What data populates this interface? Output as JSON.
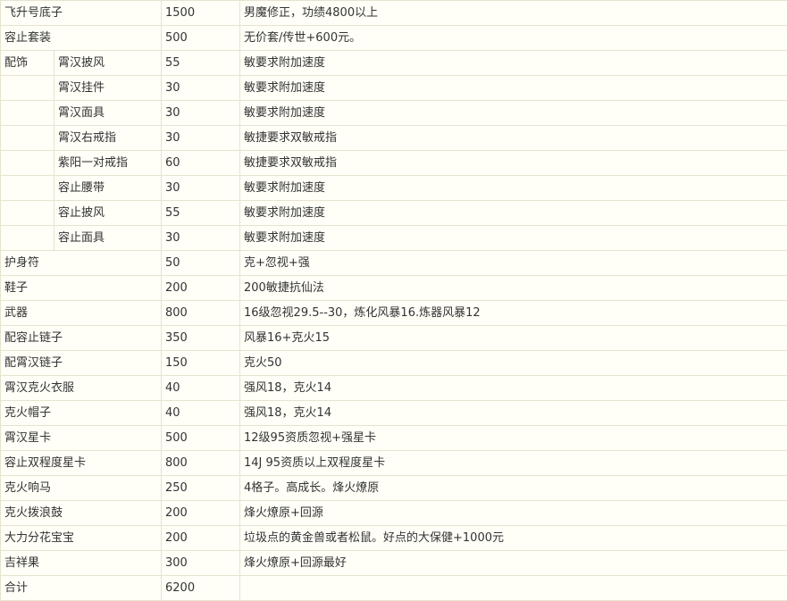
{
  "table": {
    "rows": [
      {
        "item": "飞升号底子",
        "price": "1500",
        "note": "男魔修正，功绩4800以上"
      },
      {
        "item": "容止套装",
        "price": "500",
        "note": "无价套/传世+600元。"
      },
      {
        "category": "配饰",
        "sub": "霄汉披风",
        "price": "55",
        "note": "敏要求附加速度"
      },
      {
        "sub": "霄汉挂件",
        "price": "30",
        "note": "敏要求附加速度"
      },
      {
        "sub": "霄汉面具",
        "price": "30",
        "note": "敏要求附加速度"
      },
      {
        "sub": "霄汉右戒指",
        "price": "30",
        "note": "敏捷要求双敏戒指"
      },
      {
        "sub": "紫阳一对戒指",
        "price": "60",
        "note": "敏捷要求双敏戒指"
      },
      {
        "sub": "容止腰带",
        "price": "30",
        "note": "敏要求附加速度"
      },
      {
        "sub": "容止披风",
        "price": "55",
        "note": "敏要求附加速度"
      },
      {
        "sub": "容止面具",
        "price": "30",
        "note": "敏要求附加速度"
      },
      {
        "item": "护身符",
        "price": "50",
        "note": "克+忽视+强"
      },
      {
        "item": "鞋子",
        "price": "200",
        "note": "200敏捷抗仙法"
      },
      {
        "item": "武器",
        "price": "800",
        "note": "16级忽视29.5--30，炼化风暴16.炼器风暴12"
      },
      {
        "item": "配容止链子",
        "price": "350",
        "note": "风暴16+克火15"
      },
      {
        "item": "配霄汉链子",
        "price": "150",
        "note": "克火50"
      },
      {
        "item": "霄汉克火衣服",
        "price": "40",
        "note": "强风18，克火14"
      },
      {
        "item": "克火帽子",
        "price": "40",
        "note": "强风18，克火14"
      },
      {
        "item": "霄汉星卡",
        "price": "500",
        "note": "12级95资质忽视+强星卡"
      },
      {
        "item": "容止双程度星卡",
        "price": "800",
        "note": "14J 95资质以上双程度星卡"
      },
      {
        "item": "克火响马",
        "price": "250",
        "note": "4格子。高成长。烽火燎原"
      },
      {
        "item": "克火拨浪鼓",
        "price": "200",
        "note": "烽火燎原+回源"
      },
      {
        "item": "大力分花宝宝",
        "price": "200",
        "note": "垃圾点的黄金兽或者松鼠。好点的大保健+1000元"
      },
      {
        "item": "吉祥果",
        "price": "300",
        "note": "烽火燎原+回源最好"
      },
      {
        "item": "合计",
        "price": "6200",
        "note": ""
      }
    ]
  }
}
